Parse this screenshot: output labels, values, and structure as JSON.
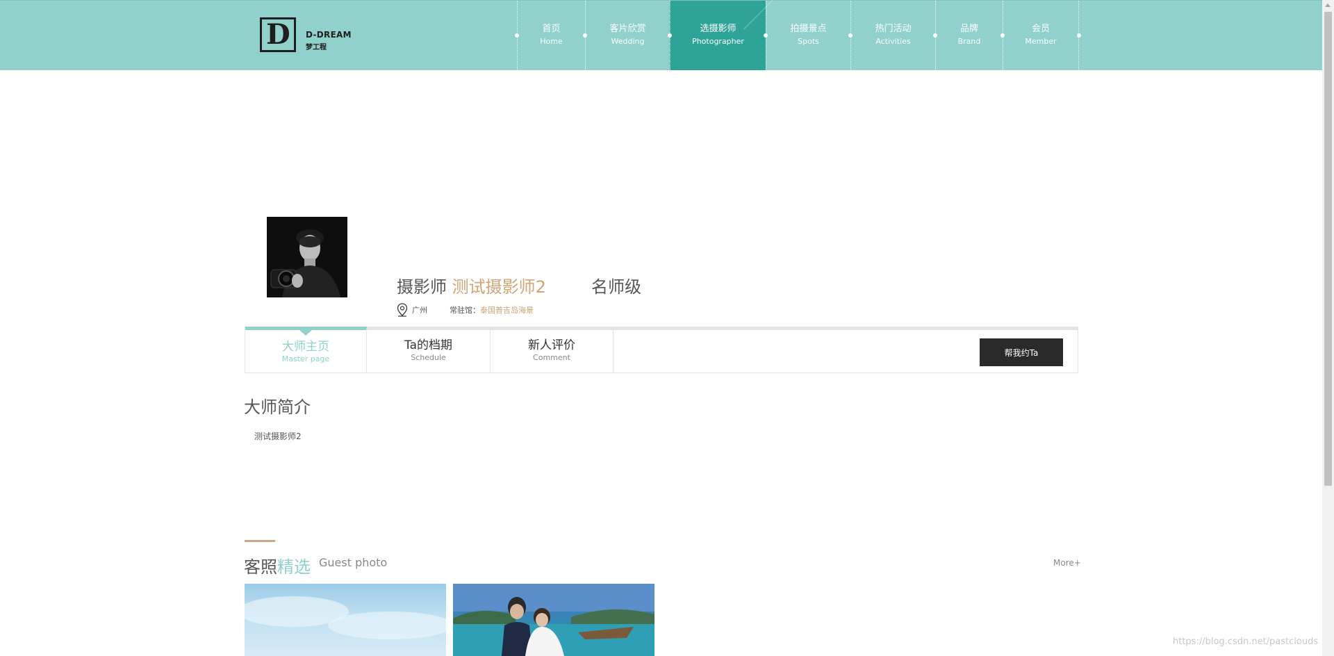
{
  "header": {
    "logo": {
      "brand": "D-DREAM",
      "sub": "梦工程",
      "mark": "D"
    },
    "nav": [
      {
        "zh": "首页",
        "en": "Home",
        "active": false
      },
      {
        "zh": "客片欣赏",
        "en": "Wedding",
        "active": false
      },
      {
        "zh": "选摄影师",
        "en": "Photographer",
        "active": true
      },
      {
        "zh": "拍摄景点",
        "en": "Spots",
        "active": false
      },
      {
        "zh": "热门活动",
        "en": "Activities",
        "active": false
      },
      {
        "zh": "品牌",
        "en": "Brand",
        "active": false
      },
      {
        "zh": "会员",
        "en": "Member",
        "active": false
      }
    ]
  },
  "profile": {
    "prefix": "摄影师",
    "name": "测试摄影师2",
    "rank": "名师级",
    "city": "广州",
    "studio_label": "常驻馆：",
    "studio": "泰国普吉岛海景"
  },
  "tabs": [
    {
      "zh": "大师主页",
      "en": "Master page",
      "active": true
    },
    {
      "zh": "Ta的档期",
      "en": "Schedule",
      "active": false
    },
    {
      "zh": "新人评价",
      "en": "Comment",
      "active": false
    }
  ],
  "book_button": "帮我约Ta",
  "intro": {
    "title": "大师简介",
    "text": "测试摄影师2"
  },
  "guest_photos": {
    "title_a": "客照",
    "title_b": "精选",
    "title_en": "Guest photo",
    "more": "More+"
  },
  "watermark": "https://blog.csdn.net/pastclouds",
  "colors": {
    "header_bg": "#91d1cb",
    "nav_active": "#2ea397",
    "accent_gold": "#d1a476",
    "accent_teal": "#91d1cb",
    "button_dark": "#2a2a2a"
  }
}
